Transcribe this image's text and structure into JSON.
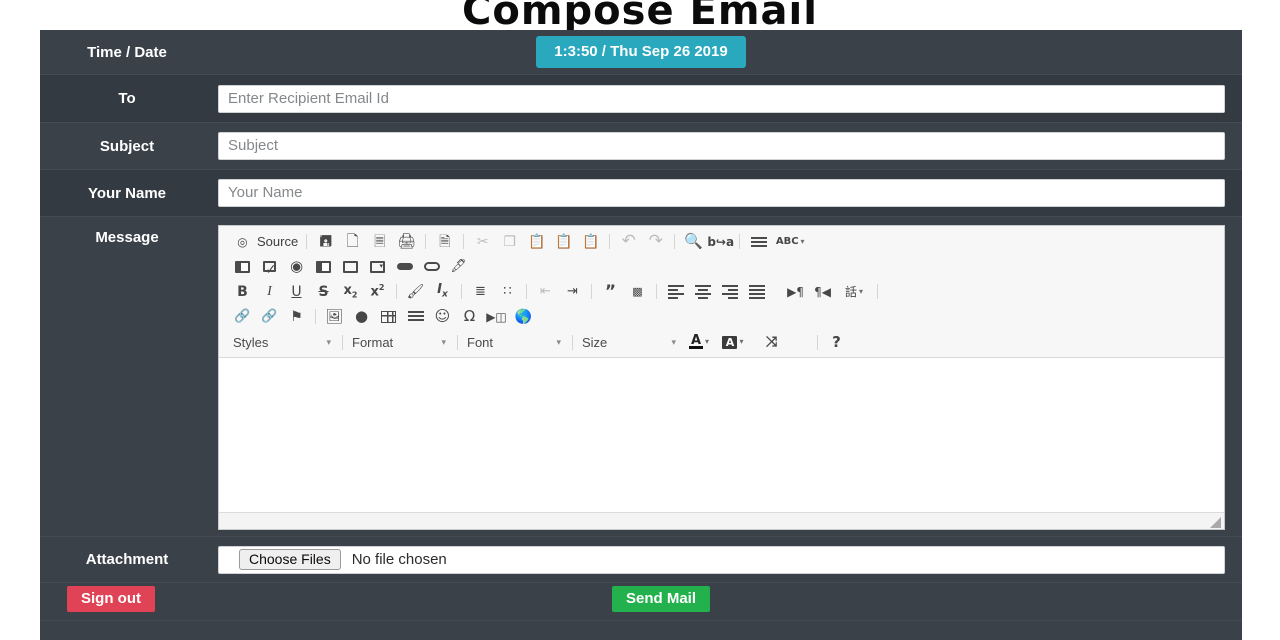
{
  "page": {
    "title": "Compose Email"
  },
  "form": {
    "time_row": {
      "label": "Time / Date",
      "badge": "1:3:50 / Thu Sep 26 2019",
      "badge_color": "#2aa8bd"
    },
    "to": {
      "label": "To",
      "placeholder": "Enter Recipient Email Id",
      "value": ""
    },
    "subject": {
      "label": "Subject",
      "placeholder": "Subject",
      "value": ""
    },
    "your_name": {
      "label": "Your Name",
      "placeholder": "Your Name",
      "value": ""
    },
    "message": {
      "label": "Message",
      "value": ""
    },
    "attachment": {
      "label": "Attachment",
      "button": "Choose Files",
      "status": "No file chosen"
    }
  },
  "editor": {
    "source_label": "Source",
    "toolbar_row1": [
      {
        "name": "source-icon",
        "glyph": "⧉"
      },
      {
        "name": "save-icon",
        "glyph": "💾"
      },
      {
        "name": "new-page-icon",
        "glyph": "🗋"
      },
      {
        "name": "preview-icon",
        "glyph": "🗏"
      },
      {
        "name": "print-icon",
        "glyph": "🖨"
      },
      {
        "name": "templates-icon",
        "glyph": "🗎"
      },
      {
        "name": "cut-icon",
        "glyph": "✂"
      },
      {
        "name": "copy-icon",
        "glyph": "❐"
      },
      {
        "name": "paste-icon",
        "glyph": "📋"
      },
      {
        "name": "paste-as-text-icon",
        "glyph": "📋"
      },
      {
        "name": "paste-from-word-icon",
        "glyph": "📋"
      },
      {
        "name": "undo-icon",
        "glyph": "↶"
      },
      {
        "name": "redo-icon",
        "glyph": "↷"
      },
      {
        "name": "find-icon",
        "glyph": "🔍"
      },
      {
        "name": "replace-icon",
        "glyph": "⬌"
      },
      {
        "name": "select-all-icon",
        "glyph": "≡"
      },
      {
        "name": "spell-check-icon",
        "glyph": "ABC"
      }
    ],
    "toolbar_row2": [
      {
        "name": "form-icon"
      },
      {
        "name": "checkbox-icon"
      },
      {
        "name": "radio-button-icon"
      },
      {
        "name": "text-field-icon"
      },
      {
        "name": "textarea-icon"
      },
      {
        "name": "selection-field-icon"
      },
      {
        "name": "button-icon"
      },
      {
        "name": "image-button-icon"
      },
      {
        "name": "hidden-field-icon"
      }
    ],
    "toolbar_row3": [
      {
        "name": "bold-icon",
        "glyph": "B"
      },
      {
        "name": "italic-icon",
        "glyph": "I"
      },
      {
        "name": "underline-icon",
        "glyph": "U"
      },
      {
        "name": "strikethrough-icon",
        "glyph": "S"
      },
      {
        "name": "subscript-icon",
        "glyph": "x₂"
      },
      {
        "name": "superscript-icon",
        "glyph": "x²"
      },
      {
        "name": "copy-formatting-icon",
        "glyph": "🖌"
      },
      {
        "name": "remove-format-icon",
        "glyph": "Iₓ"
      },
      {
        "name": "numbered-list-icon"
      },
      {
        "name": "bulleted-list-icon"
      },
      {
        "name": "decrease-indent-icon"
      },
      {
        "name": "increase-indent-icon"
      },
      {
        "name": "blockquote-icon",
        "glyph": "”"
      },
      {
        "name": "div-container-icon"
      },
      {
        "name": "align-left-icon"
      },
      {
        "name": "align-center-icon"
      },
      {
        "name": "align-right-icon"
      },
      {
        "name": "justify-icon"
      },
      {
        "name": "text-direction-ltr-icon"
      },
      {
        "name": "text-direction-rtl-icon"
      },
      {
        "name": "language-icon",
        "glyph": "話"
      }
    ],
    "toolbar_row4": [
      {
        "name": "link-icon",
        "glyph": "🔗"
      },
      {
        "name": "unlink-icon",
        "glyph": "🔗"
      },
      {
        "name": "anchor-icon",
        "glyph": "⚑"
      },
      {
        "name": "image-icon",
        "glyph": "🖼"
      },
      {
        "name": "flash-icon",
        "glyph": "⚡"
      },
      {
        "name": "table-icon"
      },
      {
        "name": "horizontal-rule-icon"
      },
      {
        "name": "smiley-icon",
        "glyph": "☺"
      },
      {
        "name": "special-character-icon",
        "glyph": "Ω"
      },
      {
        "name": "page-break-icon"
      },
      {
        "name": "iframe-icon",
        "glyph": "🌐"
      }
    ],
    "combos": [
      {
        "name": "styles-dropdown",
        "label": "Styles"
      },
      {
        "name": "format-dropdown",
        "label": "Format"
      },
      {
        "name": "font-dropdown",
        "label": "Font"
      },
      {
        "name": "size-dropdown",
        "label": "Size"
      }
    ],
    "color_tools": [
      {
        "name": "text-color-button",
        "glyph": "A"
      },
      {
        "name": "background-color-button",
        "glyph": "A"
      },
      {
        "name": "maximize-button",
        "glyph": "⬌"
      },
      {
        "name": "show-blocks-button",
        "glyph": "⌸"
      },
      {
        "name": "about-button",
        "glyph": "?"
      }
    ]
  },
  "actions": {
    "sign_out": "Sign out",
    "send_mail": "Send Mail",
    "sign_out_color": "#e04356",
    "send_mail_color": "#23b14d"
  }
}
